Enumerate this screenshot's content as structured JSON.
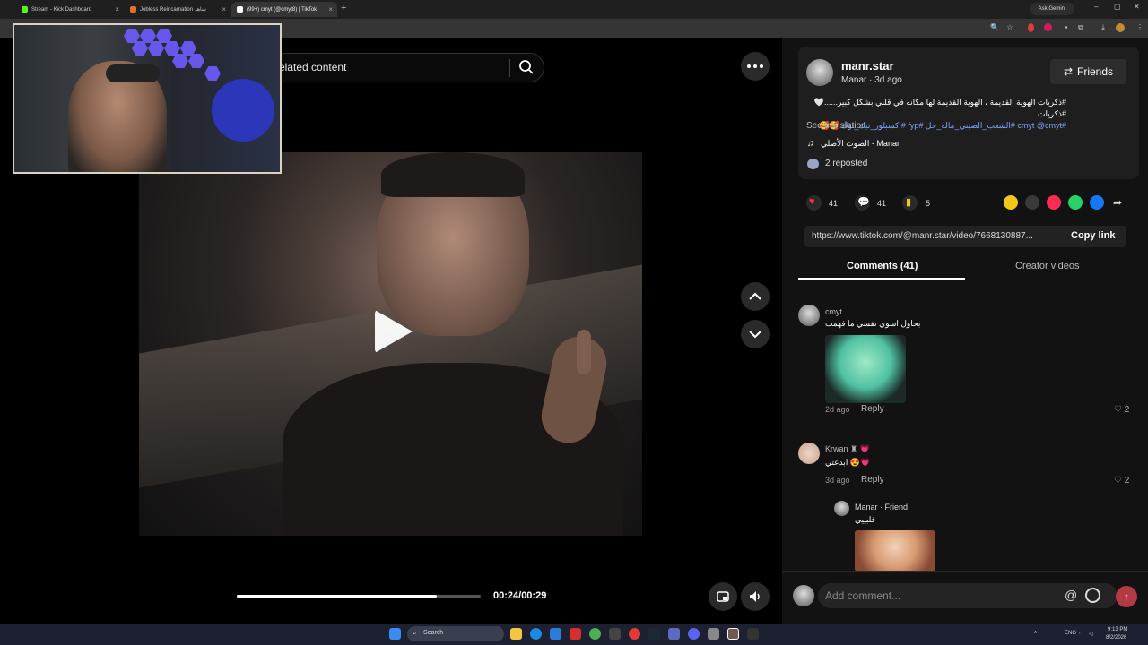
{
  "browser": {
    "tabs": [
      {
        "title": "Stream - Kick Dashboard",
        "color": "#53fc18"
      },
      {
        "title": "Jobless Reincarnation شاهد",
        "color": "#e0702a"
      },
      {
        "title": "(99+) cmyt (@cmyt8) | TikTok",
        "color": "#ffffff"
      }
    ],
    "ask_gemini": "Ask Gemini"
  },
  "video": {
    "search_text": "elated content",
    "current_time": "00:24/00:29",
    "progress": 0.82
  },
  "post": {
    "username": "manr.star",
    "subline": "Manar · 3d ago",
    "friends_label": "Friends",
    "description_line1": "#ذكريات الهوية القديمة ، الهوية القديمة لها مكانه في قلبي بشكل كبير......🤍 #ذكريات",
    "description_hashtags1": "#cmyt @cmyt",
    "description_line2": "#الشعب_الصيني_ماله_حل #fyp #اكسبلور_تيك_توك 🥰🥰",
    "see_translation": "See translation",
    "sound": "الصوت الأصلي - Manar",
    "reposted": "2 reposted",
    "likes": "41",
    "comments_count": "41",
    "saves": "5",
    "link": "https://www.tiktok.com/@manr.star/video/7668130887...",
    "copy_link": "Copy link",
    "share_colors": [
      "#f5c518",
      "#3a3a3a",
      "#fe2c55",
      "#25d366",
      "#1877f2",
      "#2a2a2a"
    ]
  },
  "tabs": {
    "comments": "Comments (41)",
    "creator": "Creator videos"
  },
  "comments": [
    {
      "name": "cmyt",
      "text": "بحاول اسوي نفسي ما فهمت",
      "meta": "2d ago",
      "reply": "Reply",
      "likes": "2"
    },
    {
      "name": "Krwan ♜ 💗",
      "text": "ابدعتي 😍💗",
      "meta": "3d ago",
      "reply": "Reply",
      "likes": "2"
    },
    {
      "name": "Manar · Friend",
      "text": "قلبييي"
    }
  ],
  "composer": {
    "placeholder": "Add comment..."
  },
  "taskbar": {
    "search": "Search",
    "lang": "ENG",
    "time": "9:13 PM",
    "date": "8/2/2026"
  }
}
